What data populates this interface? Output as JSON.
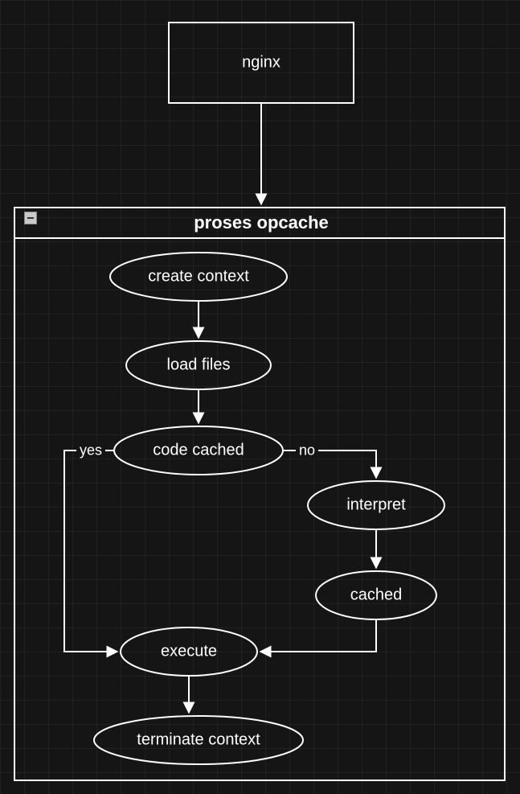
{
  "diagram": {
    "type": "flowchart",
    "title_node": "nginx",
    "container": {
      "title": "proses opcache"
    },
    "nodes": {
      "nginx": "nginx",
      "create_context": "create context",
      "load_files": "load files",
      "code_cached": "code cached",
      "interpret": "interpret",
      "cached": "cached",
      "execute": "execute",
      "terminate_context": "terminate context"
    },
    "edges": {
      "yes": "yes",
      "no": "no"
    },
    "flow": [
      [
        "nginx",
        "proses opcache container"
      ],
      [
        "create context",
        "load files"
      ],
      [
        "load files",
        "code cached"
      ],
      [
        "code cached",
        "execute",
        "yes"
      ],
      [
        "code cached",
        "interpret",
        "no"
      ],
      [
        "interpret",
        "cached"
      ],
      [
        "cached",
        "execute"
      ],
      [
        "execute",
        "terminate context"
      ]
    ]
  }
}
